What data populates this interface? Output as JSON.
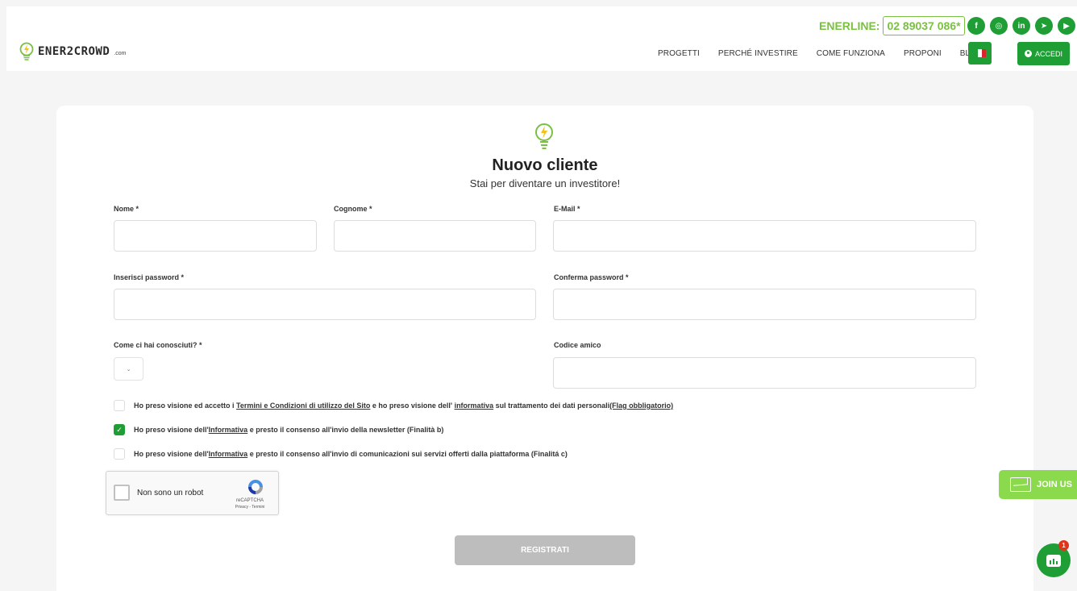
{
  "colors": {
    "brand_green": "#1e9e34",
    "light_green": "#7ac143",
    "join_green": "#8bd94d",
    "disabled_gray": "#bdbdbd"
  },
  "header": {
    "logo": {
      "text": "ENER2CROWD",
      "suffix": ".com"
    },
    "enerline": {
      "label": "ENERLINE:",
      "number": "02 89037 086*"
    },
    "socials": [
      {
        "icon": "facebook-icon",
        "glyph": "f"
      },
      {
        "icon": "instagram-icon",
        "glyph": "◎"
      },
      {
        "icon": "linkedin-icon",
        "glyph": "in"
      },
      {
        "icon": "telegram-icon",
        "glyph": "➤"
      },
      {
        "icon": "youtube-icon",
        "glyph": "▶"
      }
    ],
    "nav": [
      "PROGETTI",
      "PERCHÉ INVESTIRE",
      "COME FUNZIONA",
      "PROPONI",
      "BLOG"
    ],
    "language_flag": "italian-flag-icon",
    "login_label": "ACCEDI"
  },
  "form": {
    "title": "Nuovo cliente",
    "subtitle": "Stai per diventare un investitore!",
    "fields": {
      "nome": {
        "label": "Nome *",
        "value": ""
      },
      "cognome": {
        "label": "Cognome *",
        "value": ""
      },
      "email": {
        "label": "E-Mail *",
        "value": ""
      },
      "password": {
        "label": "Inserisci password *",
        "value": ""
      },
      "confirm_password": {
        "label": "Conferma password *",
        "value": ""
      },
      "source": {
        "label": "Come ci hai conosciuti? *",
        "value": ""
      },
      "friend_code": {
        "label": "Codice amico",
        "value": ""
      }
    },
    "consents": [
      {
        "checked": false,
        "before": "Ho preso visione ed accetto i ",
        "link1": "Termini e Condizioni di utilizzo del Sito",
        "middle": " e ho preso visione dell' ",
        "link2": "informativa",
        "after": " sul trattamento dei dati personali",
        "link3": "(Flag obbligatorio)"
      },
      {
        "checked": true,
        "before": "Ho preso visione dell'",
        "link1": "Informativa",
        "after": " e presto il consenso all'invio della newsletter (Finalità b)"
      },
      {
        "checked": false,
        "before": "Ho preso visione dell'",
        "link1": "Informativa",
        "after": " e presto il consenso all'invio di comunicazioni sui servizi offerti dalla piattaforma (Finalitá c)"
      }
    ],
    "captcha": {
      "label": "Non sono un robot",
      "brand": "reCAPTCHA",
      "terms": "Privacy - Termini"
    },
    "submit_label": "REGISTRATI"
  },
  "floating": {
    "join_label": "JOIN US",
    "chat_badge": "1"
  }
}
